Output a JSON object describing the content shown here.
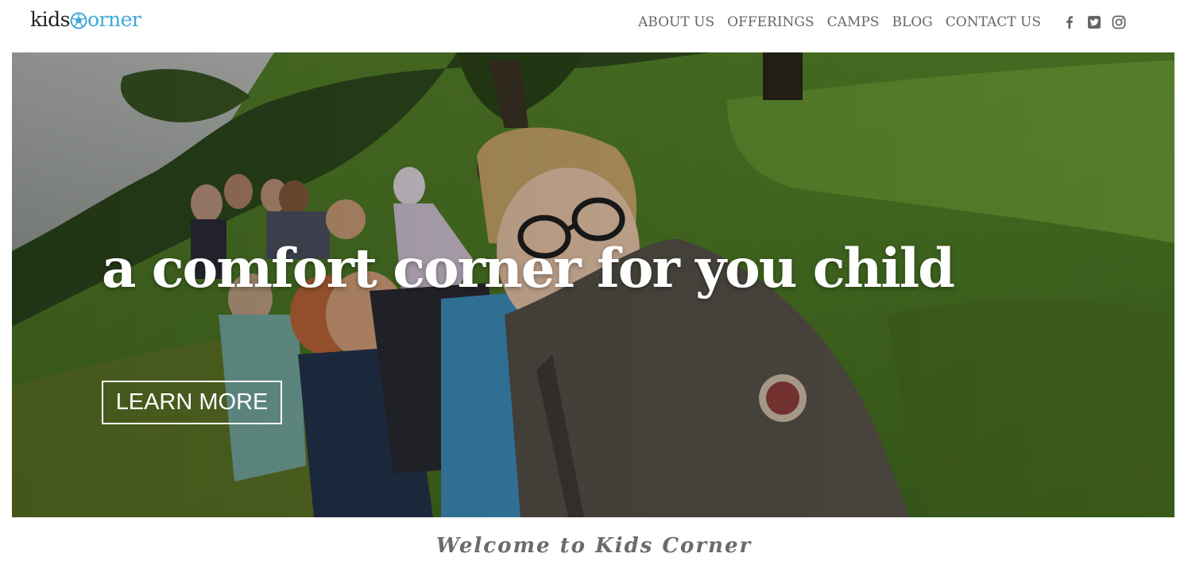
{
  "logo": {
    "part1": "kids",
    "part2": "orner",
    "icon": "soccer-ball-icon",
    "accent_color": "#3fa9d8"
  },
  "nav": {
    "items": [
      {
        "label": "ABOUT US"
      },
      {
        "label": "OFFERINGS"
      },
      {
        "label": "CAMPS"
      },
      {
        "label": "BLOG"
      },
      {
        "label": "CONTACT US"
      }
    ],
    "social": [
      {
        "icon": "facebook-icon"
      },
      {
        "icon": "twitter-icon"
      },
      {
        "icon": "instagram-icon"
      }
    ]
  },
  "hero": {
    "title": "a comfort corner for you child",
    "cta_label": "LEARN MORE",
    "image": "photo of children in a line outdoors on a grassy hill"
  },
  "welcome": {
    "title": "Welcome to Kids Corner"
  }
}
